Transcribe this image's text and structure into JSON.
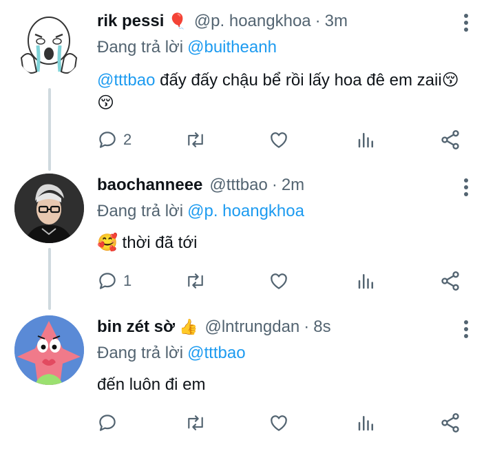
{
  "tweets": [
    {
      "name": "rik pessi",
      "name_emoji": "🎈",
      "handle": "@p. hoangkhoa",
      "dot": "·",
      "time": "3m",
      "reply_prefix": "Đang trả lời",
      "reply_to": "@buitheanh",
      "mention": "@tttbao",
      "text": " đấy đấy chậu bể rồi lấy hoa đê em zaii😚😚",
      "reply_count": "2",
      "avatar_icon": "meme-face-avatar"
    },
    {
      "name": "baochanneee",
      "name_emoji": "",
      "handle": "@tttbao",
      "dot": "·",
      "time": "2m",
      "reply_prefix": "Đang trả lời",
      "reply_to": "@p. hoangkhoa",
      "mention": "",
      "text": "🥰 thời đã tới",
      "reply_count": "1",
      "avatar_icon": "person-glasses-avatar"
    },
    {
      "name": "bin zét sờ",
      "name_emoji": "👍",
      "handle": "@lntrungdan",
      "dot": "·",
      "time": "8s",
      "reply_prefix": "Đang trả lời",
      "reply_to": "@tttbao",
      "mention": "",
      "text": "đến luôn đi em",
      "reply_count": "",
      "avatar_icon": "pink-starfish-avatar"
    }
  ],
  "colors": {
    "accent": "#1d9bf0",
    "secondary_text": "#536471",
    "primary_text": "#0f1419",
    "thread_line": "#cfd9de"
  },
  "icons": [
    "reply-icon",
    "retweet-icon",
    "like-icon",
    "analytics-icon",
    "share-icon",
    "more-options-icon"
  ]
}
